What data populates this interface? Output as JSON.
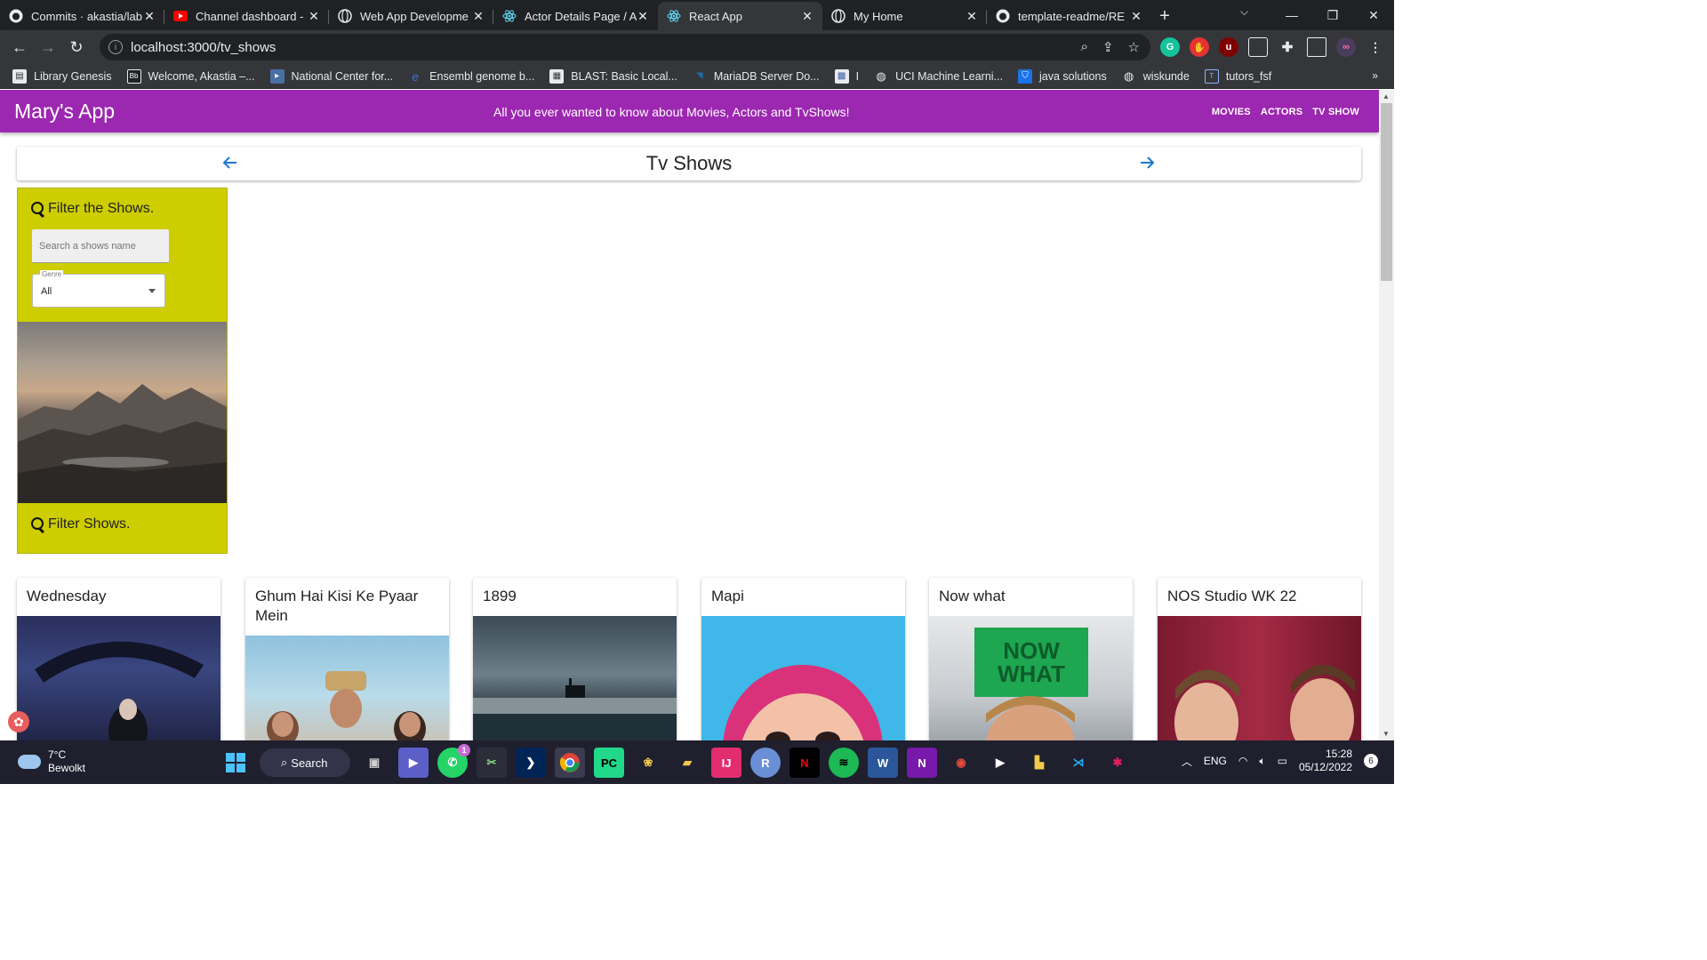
{
  "browser": {
    "tabs": [
      {
        "label": "Commits · akastia/lab",
        "icon": "github-icon"
      },
      {
        "label": "Channel dashboard - ",
        "icon": "youtube-icon"
      },
      {
        "label": "Web App Developme",
        "icon": "globe-icon"
      },
      {
        "label": "Actor Details Page / A",
        "icon": "react-icon"
      },
      {
        "label": "React App",
        "icon": "react-icon",
        "active": true
      },
      {
        "label": "My Home",
        "icon": "globe-icon"
      },
      {
        "label": "template-readme/RE",
        "icon": "github-icon"
      }
    ],
    "url": "localhost:3000/tv_shows",
    "bookmarks": [
      "Library Genesis",
      "Welcome, Akastia –...",
      "National Center for...",
      "Ensembl genome b...",
      "BLAST: Basic Local...",
      "MariaDB Server Do...",
      "I",
      "UCI Machine Learni...",
      "java solutions",
      "wiskunde",
      "tutors_fsf"
    ]
  },
  "app": {
    "brand": "Mary's App",
    "tagline": "All you ever wanted to know about Movies, Actors and TvShows!",
    "nav": [
      "MOVIES",
      "ACTORS",
      "TV SHOW"
    ],
    "page_title": "Tv Shows",
    "filter": {
      "title": "Filter the Shows.",
      "search_placeholder": "Search a shows name",
      "genre_label": "Genre",
      "genre_value": "All",
      "footer": "Filter Shows."
    },
    "shows": [
      {
        "title": "Wednesday"
      },
      {
        "title": "Ghum Hai Kisi Ke Pyaar Mein"
      },
      {
        "title": "1899"
      },
      {
        "title": "Mapi"
      },
      {
        "title": "Now what"
      },
      {
        "title": "NOS Studio WK 22"
      }
    ],
    "now_what_logo": "NOW WHAT"
  },
  "taskbar": {
    "temperature": "7°C",
    "weather": "Bewolkt",
    "search": "Search",
    "language": "ENG",
    "time": "15:28",
    "date": "05/12/2022",
    "notifications": "6",
    "whatsapp_badge": "1"
  },
  "colors": {
    "appbar": "#9c27b0",
    "filter_panel": "#cdcd00",
    "link_arrow": "#1976d2"
  }
}
